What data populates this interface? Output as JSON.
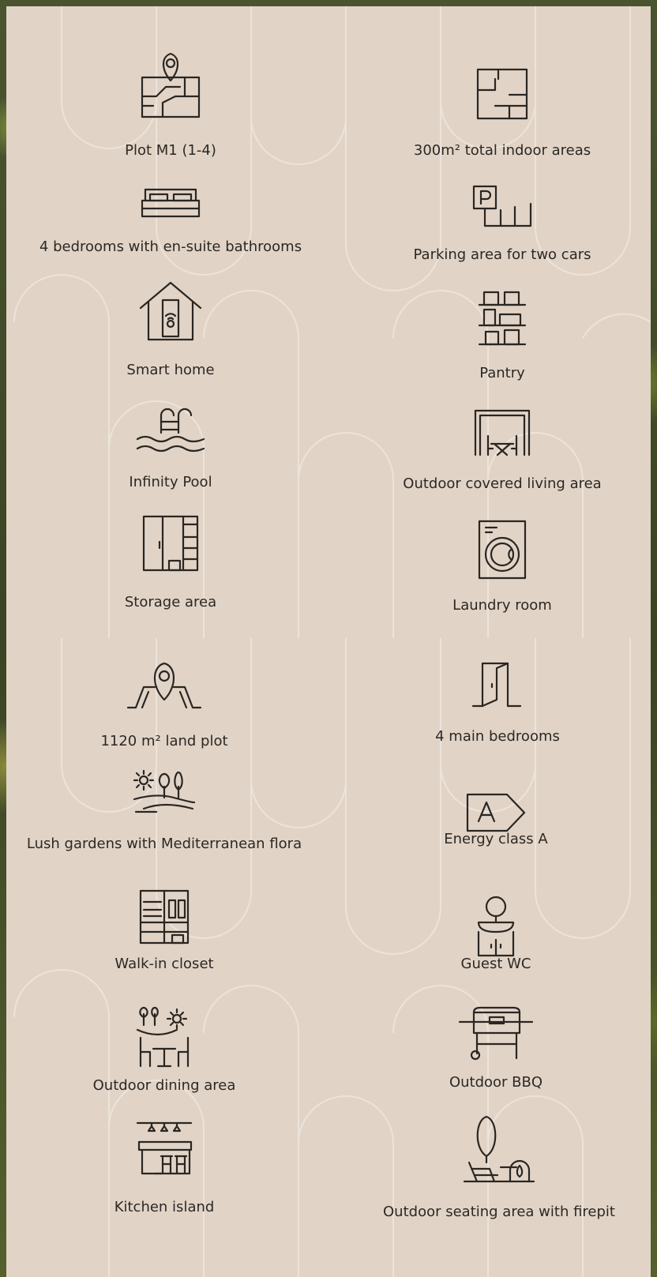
{
  "features": [
    {
      "label": "Plot M1 (1-4)",
      "icon": "plot-map-icon"
    },
    {
      "label": "300m² total indoor areas",
      "icon": "floorplan-icon"
    },
    {
      "label": "4 bedrooms with en-suite bathrooms",
      "icon": "bed-icon"
    },
    {
      "label": "Parking area for two cars",
      "icon": "parking-icon"
    },
    {
      "label": "Smart home",
      "icon": "smart-home-icon"
    },
    {
      "label": "Pantry",
      "icon": "pantry-shelves-icon"
    },
    {
      "label": "Infinity Pool",
      "icon": "pool-icon"
    },
    {
      "label": "Outdoor covered living area",
      "icon": "covered-patio-icon"
    },
    {
      "label": "Storage area",
      "icon": "storage-wardrobe-icon"
    },
    {
      "label": "Laundry room",
      "icon": "washing-machine-icon"
    },
    {
      "label": "1120 m² land plot",
      "icon": "land-plot-icon"
    },
    {
      "label": "4 main bedrooms",
      "icon": "door-icon"
    },
    {
      "label": "Lush gardens with Mediterranean flora",
      "icon": "garden-icon"
    },
    {
      "label": "Energy class A",
      "icon": "energy-class-icon"
    },
    {
      "label": "Walk-in closet",
      "icon": "closet-icon"
    },
    {
      "label": "Guest WC",
      "icon": "washbasin-icon"
    },
    {
      "label": "Outdoor dining area",
      "icon": "outdoor-dining-icon"
    },
    {
      "label": "Outdoor BBQ",
      "icon": "bbq-icon"
    },
    {
      "label": "Kitchen island",
      "icon": "kitchen-island-icon"
    },
    {
      "label": "Outdoor seating area with firepit",
      "icon": "firepit-seating-icon"
    }
  ]
}
